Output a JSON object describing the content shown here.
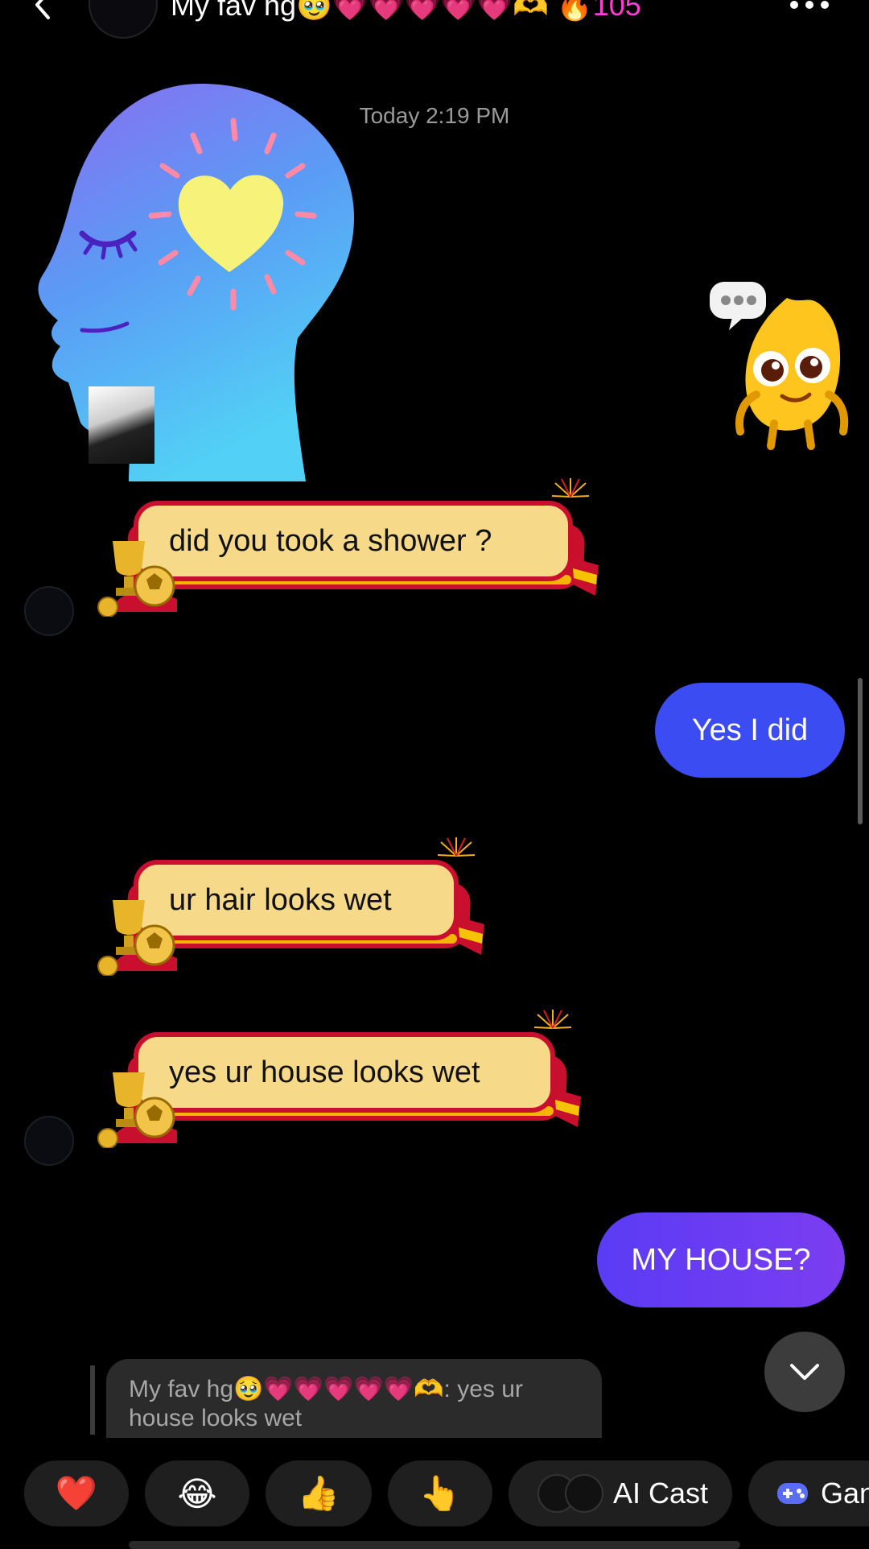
{
  "header": {
    "title": "My fav hg",
    "title_emoji": "🥹",
    "hearts": "💗💗💗💗💗",
    "hands": "🫶",
    "streak_flame": "🔥",
    "streak_count": "105"
  },
  "thread": {
    "timestamp": "Today 2:19 PM",
    "messages": [
      {
        "side": "in",
        "text": "did you took a shower ?"
      },
      {
        "side": "out",
        "text": "Yes I did"
      },
      {
        "side": "in",
        "text": "ur hair looks wet"
      },
      {
        "side": "in",
        "text": "yes ur house looks wet"
      },
      {
        "side": "out",
        "text": "MY HOUSE?"
      }
    ]
  },
  "reply_preview": {
    "sender": "My fav hg🥹💗💗💗💗💗🫶",
    "text": ": yes ur house looks wet"
  },
  "quick_replies": {
    "heart": "❤️",
    "laugh": "😂",
    "thumbs": "👍",
    "point": "👆",
    "ai_cast": "AI Cast",
    "games": "Gan"
  },
  "colors": {
    "outgoing_blue": "#3b4cf2",
    "outgoing_purple": "#6a3df2",
    "accent_pink": "#ff3fd4",
    "bubble_fill": "#f7d98a",
    "bubble_border": "#c8102e"
  }
}
